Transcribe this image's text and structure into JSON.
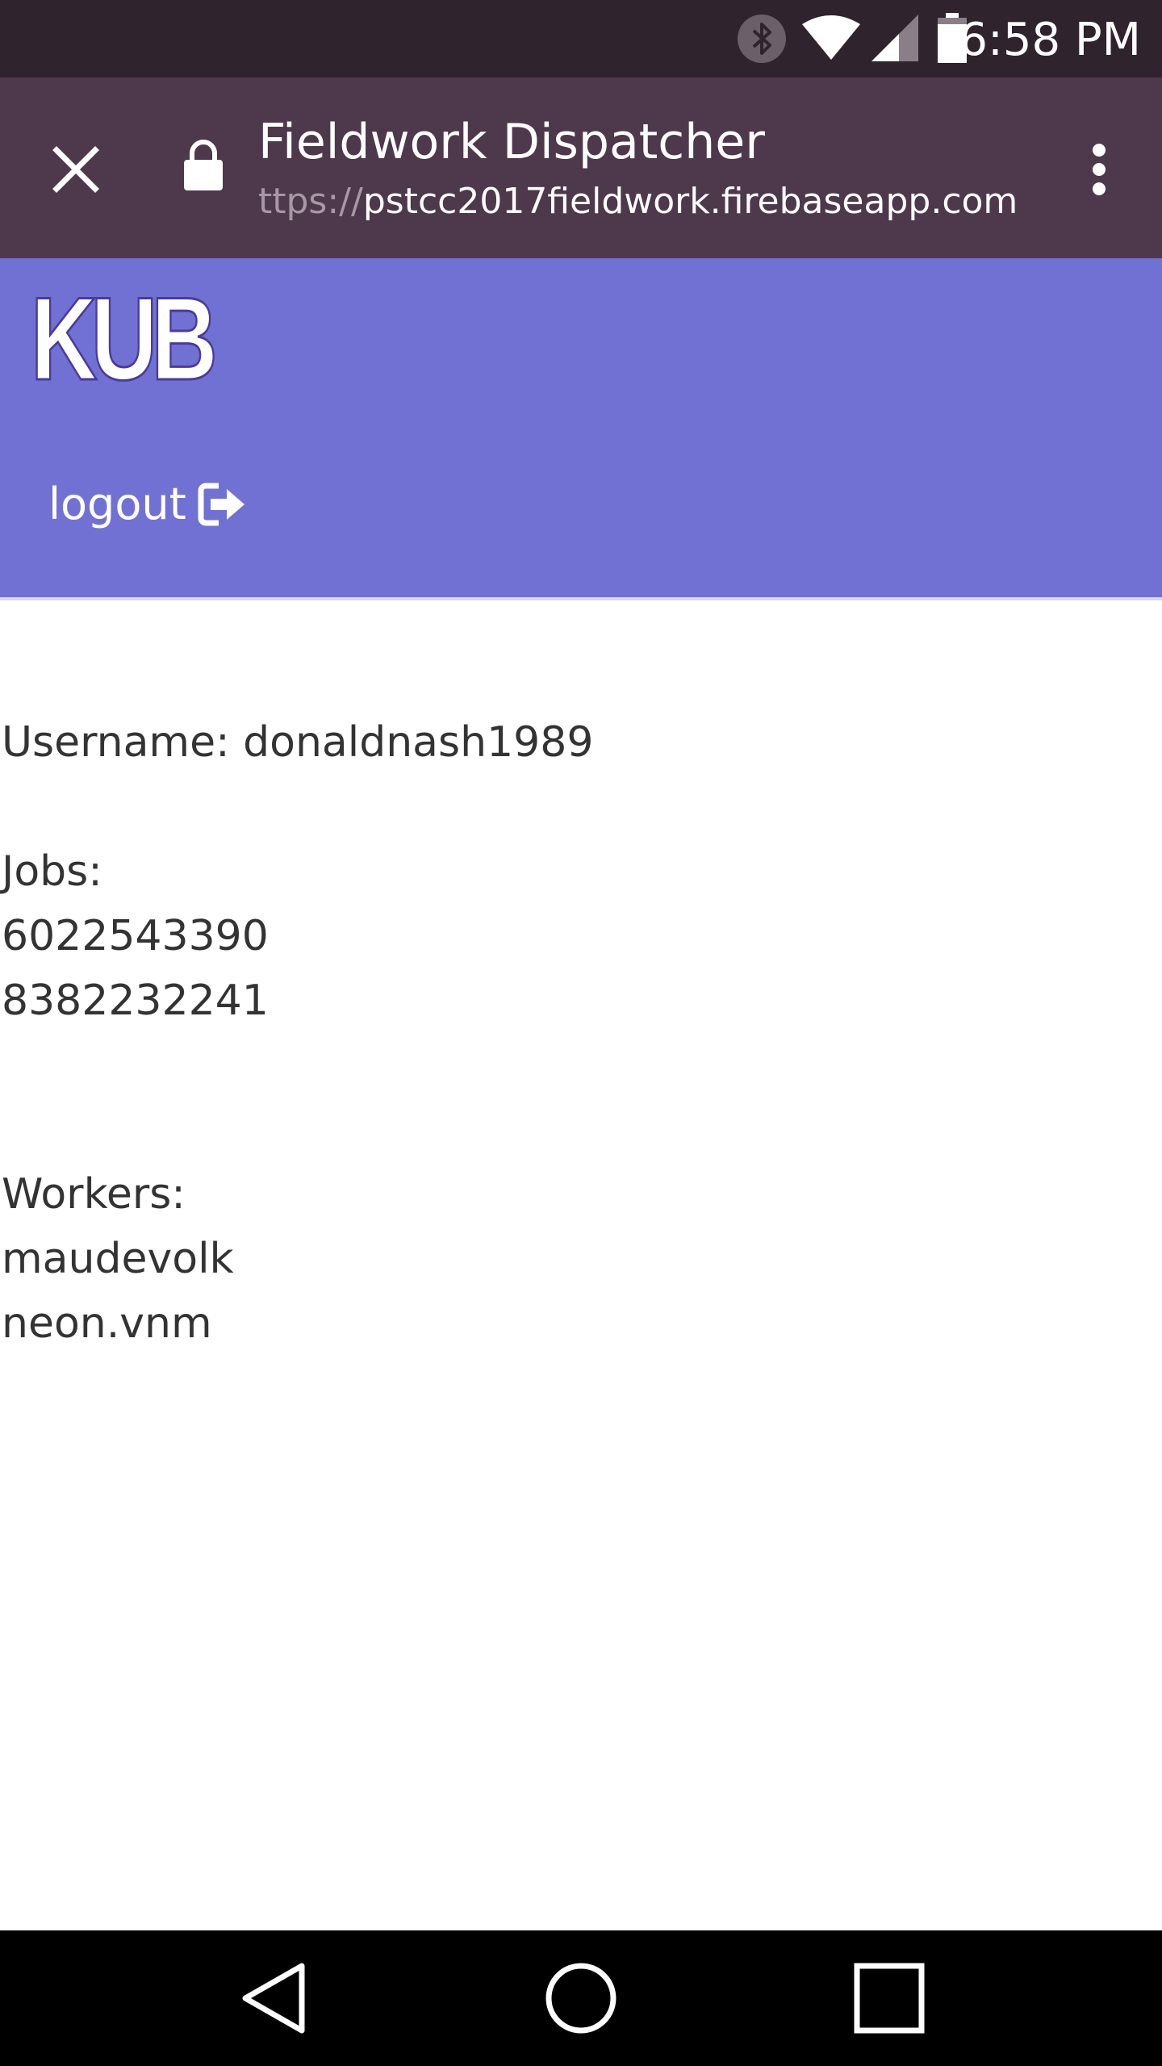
{
  "status_bar": {
    "time": "6:58 PM",
    "icons": [
      "bluetooth-icon",
      "wifi-icon",
      "signal-icon",
      "battery-icon"
    ]
  },
  "toolbar": {
    "title": "Fieldwork Dispatcher",
    "url_scheme": "ttps://",
    "url_host": "pstcc2017fieldwork.firebaseapp.com",
    "icons": [
      "close-icon",
      "lock-icon",
      "more-vert-icon"
    ]
  },
  "header": {
    "logo_text": "KUB",
    "logout_label": "logout",
    "logout_icon": "sign-out-icon",
    "background": "#7171d4"
  },
  "content": {
    "username_line": "Username: donaldnash1989",
    "jobs_label": "Jobs:",
    "jobs": [
      "6022543390",
      "8382232241"
    ],
    "workers_label": "Workers:",
    "workers": [
      "maudevolk",
      "neon.vnm"
    ]
  },
  "nav_bar": {
    "icons": [
      "back-icon",
      "home-icon",
      "recents-icon"
    ]
  }
}
